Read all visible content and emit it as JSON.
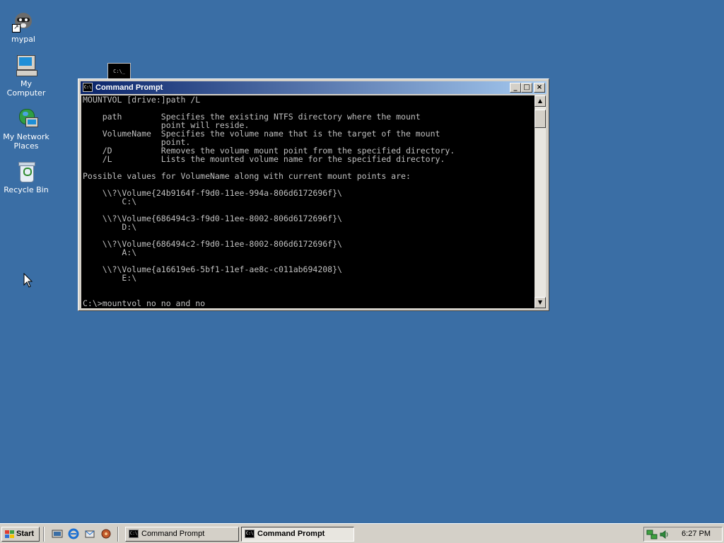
{
  "desktop": {
    "icons": [
      {
        "label": "mypal",
        "icon": "mypal-icon"
      },
      {
        "label": "My Computer",
        "icon": "my-computer-icon"
      },
      {
        "label": "My Network\nPlaces",
        "icon": "network-places-icon"
      },
      {
        "label": "Recycle Bin",
        "icon": "recycle-bin-icon"
      }
    ],
    "thumbnail_text": "C:\\_"
  },
  "window": {
    "title": "Command Prompt",
    "icon_text": "C:\\",
    "buttons": {
      "minimize": "_",
      "maximize": "□",
      "close": "×"
    },
    "console_lines": [
      "MOUNTVOL [drive:]path /L",
      "",
      "    path        Specifies the existing NTFS directory where the mount",
      "                point will reside.",
      "    VolumeName  Specifies the volume name that is the target of the mount",
      "                point.",
      "    /D          Removes the volume mount point from the specified directory.",
      "    /L          Lists the mounted volume name for the specified directory.",
      "",
      "Possible values for VolumeName along with current mount points are:",
      "",
      "    \\\\?\\Volume{24b9164f-f9d0-11ee-994a-806d6172696f}\\",
      "        C:\\",
      "",
      "    \\\\?\\Volume{686494c3-f9d0-11ee-8002-806d6172696f}\\",
      "        D:\\",
      "",
      "    \\\\?\\Volume{686494c2-f9d0-11ee-8002-806d6172696f}\\",
      "        A:\\",
      "",
      "    \\\\?\\Volume{a16619e6-5bf1-11ef-ae8c-c011ab694208}\\",
      "        E:\\",
      "",
      "",
      "C:\\>mountvol no no and no"
    ],
    "scroll": {
      "up": "▲",
      "down": "▼"
    }
  },
  "taskbar": {
    "start_label": "Start",
    "quick_launch": [
      "show-desktop-icon",
      "internet-explorer-icon",
      "outlook-express-icon",
      "media-player-icon"
    ],
    "tasks": [
      {
        "label": "Command Prompt",
        "active": false
      },
      {
        "label": "Command Prompt",
        "active": true
      }
    ],
    "clock": "6:27 PM",
    "tray_icons": [
      "network-tray-icon",
      "volume-tray-icon"
    ]
  }
}
